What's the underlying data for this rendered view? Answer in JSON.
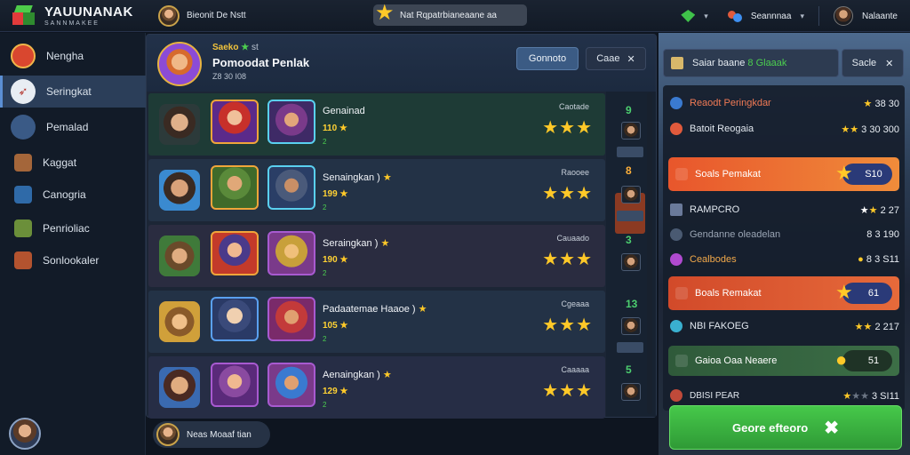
{
  "topbar": {
    "logo_title": "YAUUNANAK",
    "logo_sub": "SANNMAKEE",
    "user_name": "Bieonit De Nstt",
    "search_text": "Nat Rqpatrbianeaane aa",
    "currency_label": "Seannnaa",
    "profile_name": "Nalaante"
  },
  "sidebar": {
    "items": [
      {
        "label": "Nengha",
        "icon": "crest-icon"
      },
      {
        "label": "Seringkat",
        "icon": "sword-icon"
      },
      {
        "label": "Pemalad",
        "icon": "helmet-icon"
      },
      {
        "label": "Kaggat",
        "icon": "boot-icon"
      },
      {
        "label": "Canogria",
        "icon": "scroll-icon"
      },
      {
        "label": "Penrioliac",
        "icon": "axe-icon"
      },
      {
        "label": "Sonlookaler",
        "icon": "bag-icon"
      }
    ]
  },
  "main": {
    "header_small": "Saeko",
    "header_small_tail": "st",
    "header_title": "Pomoodat Penlak",
    "header_meta": "Z8 30 I08",
    "primary_button": "Gonnoto",
    "close_button": "Caae",
    "rows": [
      {
        "name": "Genainad",
        "name_star": false,
        "score": "110",
        "small": "2",
        "label": "Caotade",
        "stars": "★★★",
        "rank": "9"
      },
      {
        "name": "Senaingkan )",
        "name_star": true,
        "score": "199",
        "small": "2",
        "label": "Raooee",
        "stars": "★★★",
        "rank": "8"
      },
      {
        "name": "Seraingkan )",
        "name_star": true,
        "score": "190",
        "small": "2",
        "label": "Cauaado",
        "stars": "★★★",
        "rank": "3"
      },
      {
        "name": "Padaatemae Haaoe )",
        "name_star": true,
        "score": "105",
        "small": "2",
        "label": "Cgeaaa",
        "stars": "★★★",
        "rank": "13"
      },
      {
        "name": "Aenaingkan )",
        "name_star": true,
        "score": "129",
        "small": "2",
        "label": "Caaaaa",
        "stars": "★★★",
        "rank": "5"
      }
    ],
    "chat_label": "Neas Moaaf tian"
  },
  "right_panel": {
    "tab_label": "Saiar baane",
    "tab_label_green": "8 Glaaak",
    "button_label": "Sacle",
    "rows": [
      {
        "label": "Reaodt Peringkdar",
        "value": "38 30"
      },
      {
        "label": "Batoit Reogaia",
        "value": "3 30 300"
      },
      {
        "label": "RAMPCRO",
        "value": "2 27"
      },
      {
        "label": "Gendanne oleadelan",
        "value": "8 3 190"
      },
      {
        "label": "Cealbodes",
        "value": "8 3 S11"
      },
      {
        "label": "NBI FAKOEG",
        "value": "2 217"
      },
      {
        "label": "DBISI PEAR",
        "value": "3 SI11"
      }
    ],
    "highlights": [
      {
        "label": "Soals Pemakat",
        "value": "S10"
      },
      {
        "label": "Boals Remakat",
        "value": "61"
      },
      {
        "label": "Gaioa Oaa Neaere",
        "value": "51"
      }
    ],
    "cta_label": "Geore efteoro"
  },
  "colors": {
    "accent_green": "#46c84a",
    "accent_gold": "#ffc928",
    "highlight_orange": "#e8562c",
    "panel_bg": "#1c2636"
  }
}
